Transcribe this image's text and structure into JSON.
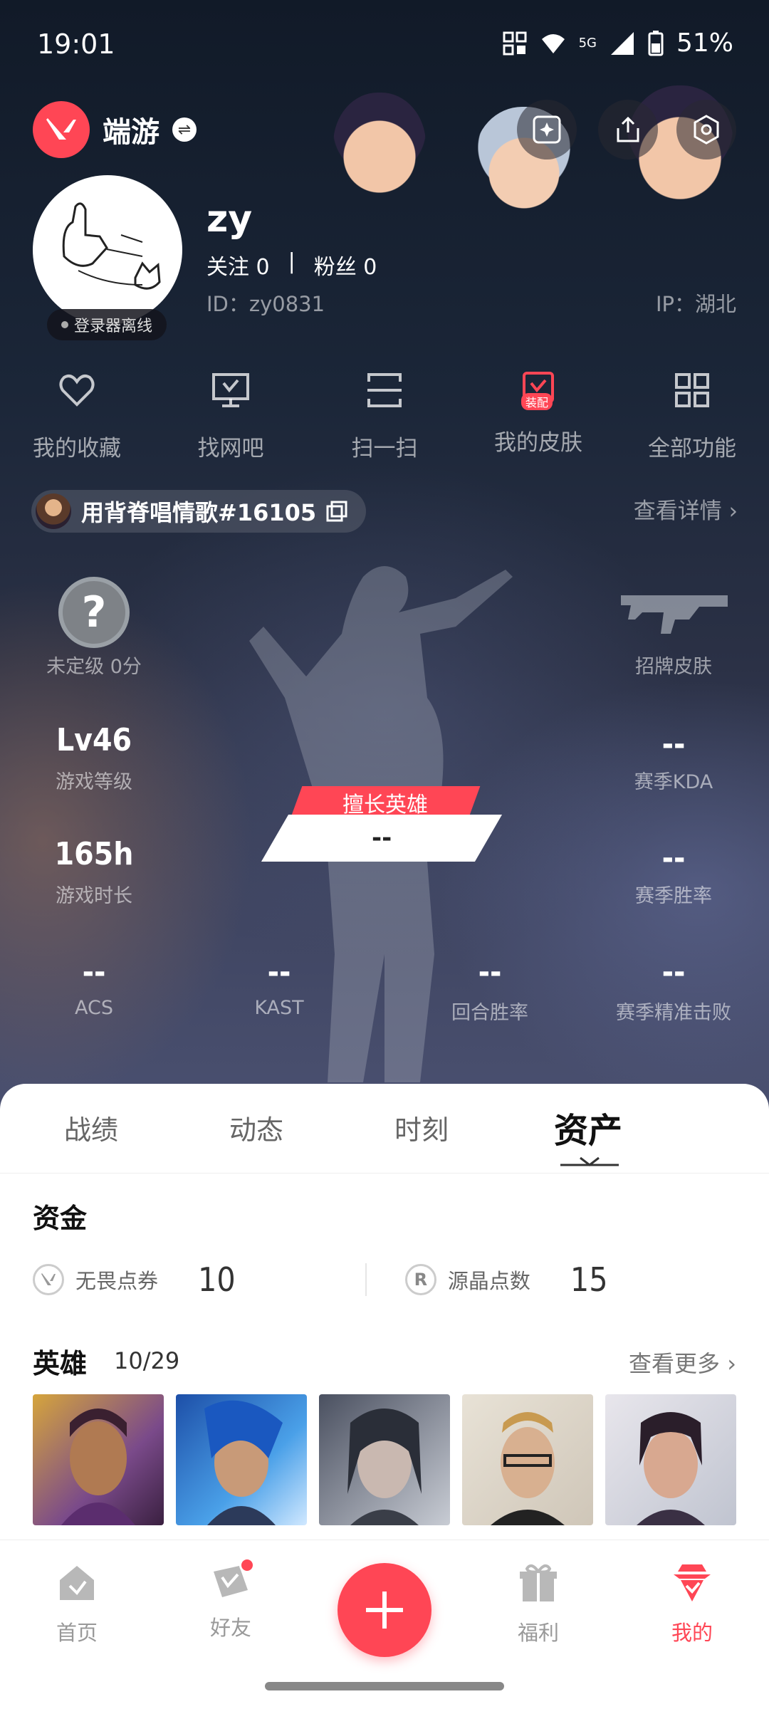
{
  "status_bar": {
    "time": "19:01",
    "battery": "51%",
    "network": "5G"
  },
  "header": {
    "brand_name": "端游",
    "brand_icon": "valorant-logo-icon"
  },
  "profile": {
    "username": "zy",
    "follow_label": "关注",
    "follow_count": "0",
    "separator": "|",
    "fans_label": "粉丝",
    "fans_count": "0",
    "id_text": "ID：zy0831",
    "ip_text": "IP：湖北",
    "login_status": "登录器离线"
  },
  "quick_actions": [
    {
      "label": "我的收藏",
      "icon": "heart-icon"
    },
    {
      "label": "找网吧",
      "icon": "monitor-icon"
    },
    {
      "label": "扫一扫",
      "icon": "scan-icon"
    },
    {
      "label": "我的皮肤",
      "icon": "skin-icon",
      "badge": "装配"
    },
    {
      "label": "全部功能",
      "icon": "grid-icon"
    }
  ],
  "riot": {
    "name": "用背脊唱情歌#16105",
    "detail_link": "查看详情"
  },
  "stats": {
    "rank_label": "未定级 0分",
    "rank_symbol": "?",
    "level_value": "Lv46",
    "level_label": "游戏等级",
    "playtime_value": "165h",
    "playtime_label": "游戏时长",
    "skin_label": "招牌皮肤",
    "kda_value": "--",
    "kda_label": "赛季KDA",
    "winrate_value": "--",
    "winrate_label": "赛季胜率",
    "best_hero_badge": "擅长英雄",
    "best_hero_value": "--",
    "bottom": [
      {
        "value": "--",
        "label": "ACS"
      },
      {
        "value": "--",
        "label": "KAST"
      },
      {
        "value": "--",
        "label": "回合胜率"
      },
      {
        "value": "--",
        "label": "赛季精准击败"
      }
    ]
  },
  "tabs": [
    "战绩",
    "动态",
    "时刻",
    "资产"
  ],
  "active_tab": "资产",
  "assets": {
    "funds_title": "资金",
    "vp_label": "无畏点券",
    "vp_value": "10",
    "rp_label": "源晶点数",
    "rp_value": "15",
    "rp_symbol": "R",
    "heroes_title": "英雄",
    "heroes_count": "10/29",
    "more_link": "查看更多"
  },
  "bottom_nav": [
    {
      "label": "首页",
      "icon": "home-icon"
    },
    {
      "label": "好友",
      "icon": "friends-icon"
    },
    {
      "label": "福利",
      "icon": "gift-icon"
    },
    {
      "label": "我的",
      "icon": "me-icon"
    }
  ],
  "colors": {
    "accent": "#ff4655",
    "hero_bg": "#1b2638"
  }
}
